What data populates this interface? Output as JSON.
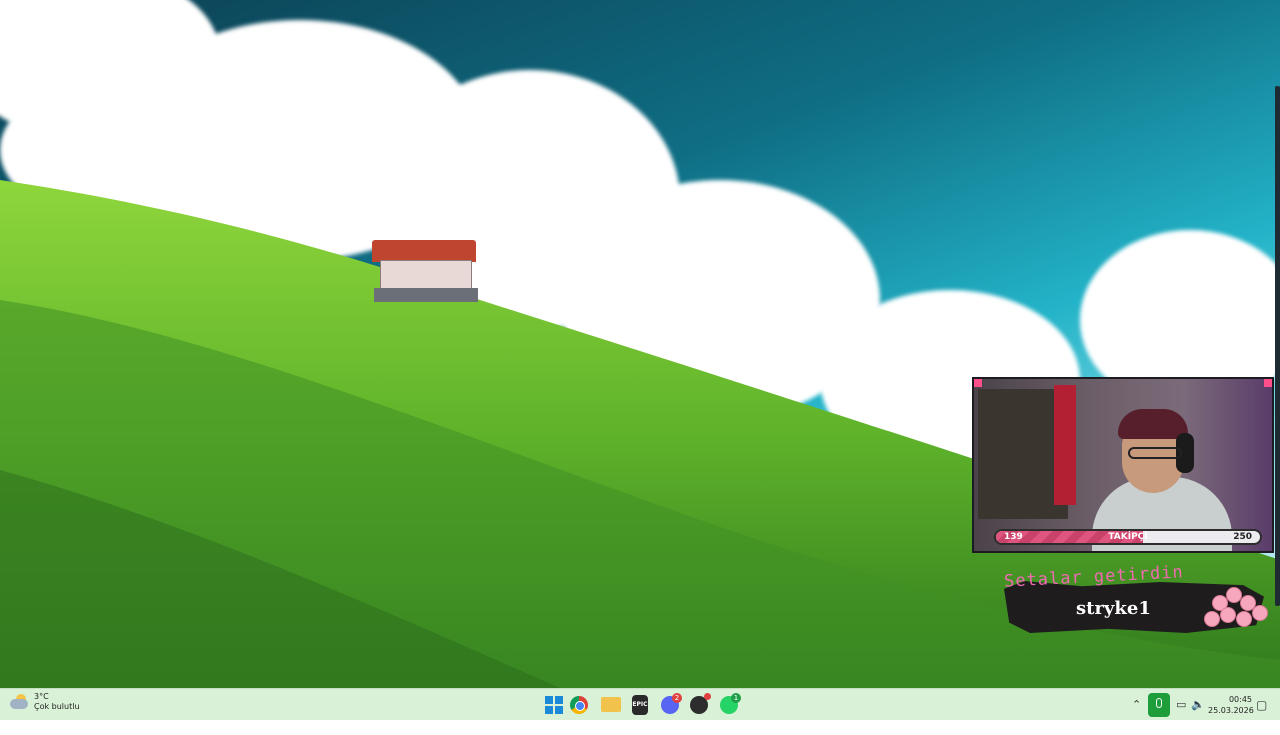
{
  "desktop": {
    "wallpaper": "hillside-house-sky"
  },
  "webcam_overlay": {
    "follower_goal": {
      "current": "139",
      "label": "TAKİPÇİ",
      "target": "250",
      "progress_fraction": 0.556
    },
    "accent_color": "#e0557f"
  },
  "gift_alert": {
    "message": "Setalar getirdin",
    "username": "stryke1",
    "text_color": "#f06ab0"
  },
  "taskbar": {
    "weather": {
      "temperature": "3°C",
      "condition": "Çok bulutlu",
      "icon": "partly-cloudy-icon"
    },
    "apps": [
      {
        "name": "start",
        "icon": "windows-icon"
      },
      {
        "name": "chrome",
        "icon": "chrome-icon"
      },
      {
        "name": "file-explorer",
        "icon": "folder-icon"
      },
      {
        "name": "epic-games",
        "icon": "epic-games-icon",
        "text": "EPIC GAMES"
      },
      {
        "name": "discord",
        "icon": "discord-icon",
        "badge": "2"
      },
      {
        "name": "obs",
        "icon": "obs-icon"
      },
      {
        "name": "whatsapp",
        "icon": "whatsapp-icon",
        "badge": "1"
      }
    ],
    "tray": {
      "time": "00:45",
      "date": "25.03.2026"
    },
    "background_color": "#d9f1d6"
  }
}
